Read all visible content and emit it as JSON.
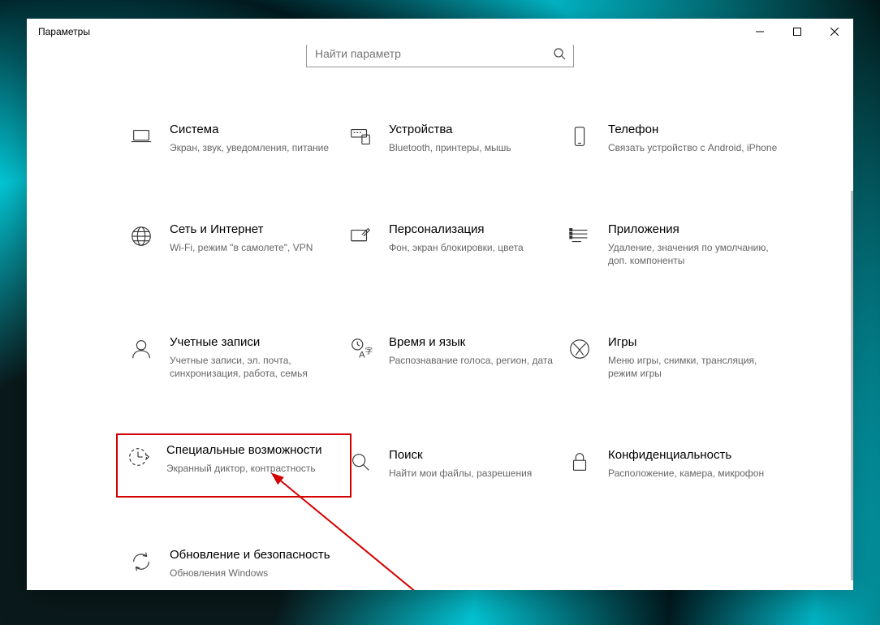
{
  "window": {
    "title": "Параметры"
  },
  "search": {
    "placeholder": "Найти параметр"
  },
  "tiles": [
    {
      "title": "Система",
      "desc": "Экран, звук, уведомления, питание"
    },
    {
      "title": "Устройства",
      "desc": "Bluetooth, принтеры, мышь"
    },
    {
      "title": "Телефон",
      "desc": "Связать устройство с Android, iPhone"
    },
    {
      "title": "Сеть и Интернет",
      "desc": "Wi-Fi, режим \"в самолете\", VPN"
    },
    {
      "title": "Персонализация",
      "desc": "Фон, экран блокировки, цвета"
    },
    {
      "title": "Приложения",
      "desc": "Удаление, значения по умолчанию, доп. компоненты"
    },
    {
      "title": "Учетные записи",
      "desc": "Учетные записи, эл. почта, синхронизация, работа, семья"
    },
    {
      "title": "Время и язык",
      "desc": "Распознавание голоса, регион, дата"
    },
    {
      "title": "Игры",
      "desc": "Меню игры, снимки, трансляция, режим игры"
    },
    {
      "title": "Специальные возможности",
      "desc": "Экранный диктор, контрастность"
    },
    {
      "title": "Поиск",
      "desc": "Найти мои файлы, разрешения"
    },
    {
      "title": "Конфиденциальность",
      "desc": "Расположение, камера, микрофон"
    },
    {
      "title": "Обновление и безопасность",
      "desc": "Обновления Windows"
    }
  ]
}
